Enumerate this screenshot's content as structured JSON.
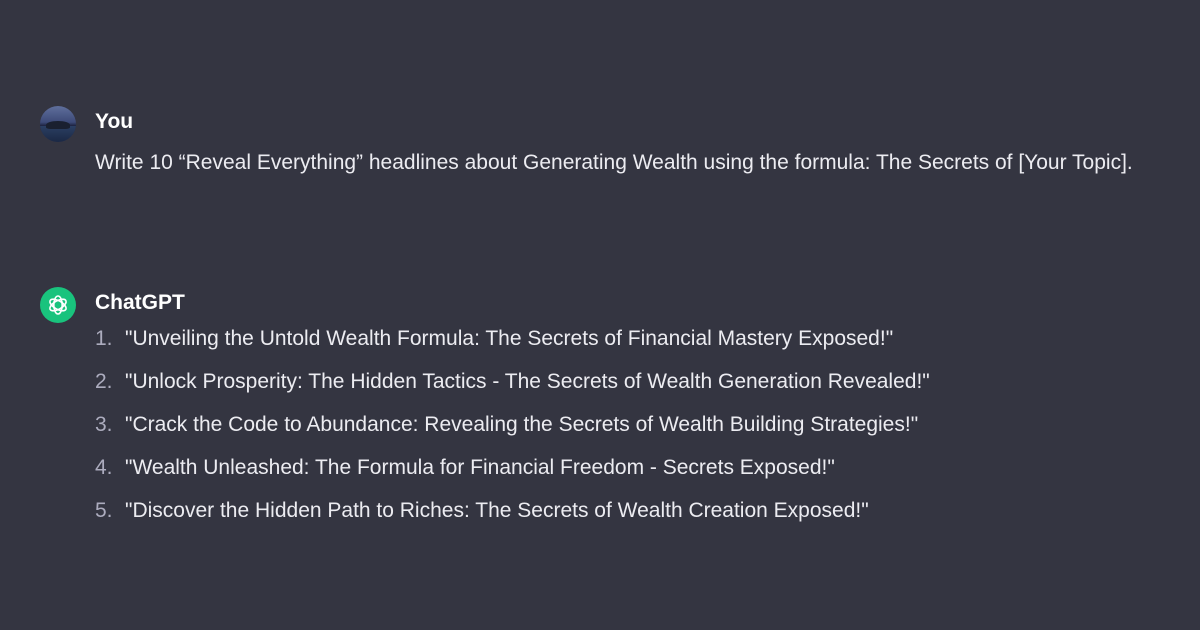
{
  "conversation": {
    "user_message": {
      "author": "You",
      "avatar_icon": "user-avatar-photo",
      "text": "Write 10 “Reveal Everything” headlines about Generating Wealth using the formula: The Secrets of [Your Topic]."
    },
    "assistant_message": {
      "author": "ChatGPT",
      "avatar_icon": "openai-logo-icon",
      "avatar_color": "#19c37d",
      "items": [
        {
          "number": "1.",
          "text": "\"Unveiling the Untold Wealth Formula: The Secrets of Financial Mastery Exposed!\""
        },
        {
          "number": "2.",
          "text": "\"Unlock Prosperity: The Hidden Tactics - The Secrets of Wealth Generation Revealed!\""
        },
        {
          "number": "3.",
          "text": "\"Crack the Code to Abundance: Revealing the Secrets of Wealth Building Strategies!\""
        },
        {
          "number": "4.",
          "text": "\"Wealth Unleashed: The Formula for Financial Freedom - Secrets Exposed!\""
        },
        {
          "number": "5.",
          "text": "\"Discover the Hidden Path to Riches: The Secrets of Wealth Creation Exposed!\""
        }
      ]
    }
  },
  "colors": {
    "background": "#343541",
    "text": "#ececf1",
    "muted": "#acacbe"
  }
}
